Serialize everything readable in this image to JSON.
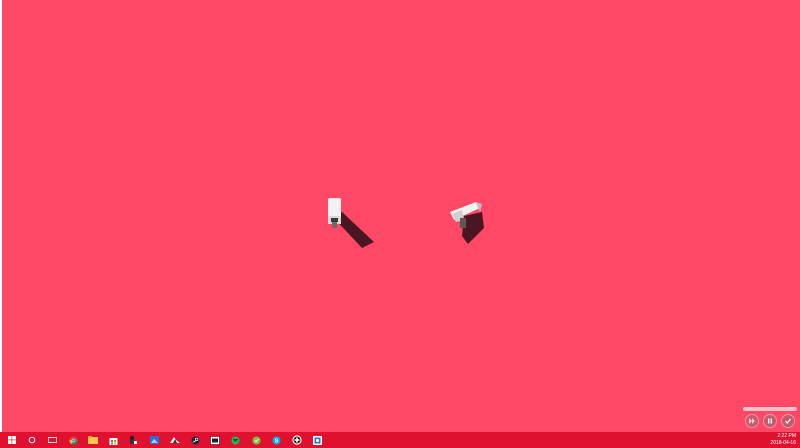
{
  "desktop": {
    "background_color": "#ff4766",
    "items": [
      {
        "name": "security-camera-left",
        "icon": "security-camera-icon"
      },
      {
        "name": "security-camera-right",
        "icon": "security-camera-icon"
      }
    ]
  },
  "overlay": {
    "label": "",
    "buttons": [
      {
        "name": "skip-button",
        "icon": "skip-icon"
      },
      {
        "name": "pause-button",
        "icon": "pause-icon"
      },
      {
        "name": "confirm-button",
        "icon": "check-icon"
      }
    ]
  },
  "taskbar": {
    "color": "#e0102f",
    "items": [
      {
        "name": "start-button",
        "icon": "windows-logo-icon"
      },
      {
        "name": "search-button",
        "icon": "circle-search-icon"
      },
      {
        "name": "task-view-button",
        "icon": "task-view-icon"
      },
      {
        "name": "chrome-button",
        "icon": "chrome-icon"
      },
      {
        "name": "file-explorer-button",
        "icon": "folder-icon"
      },
      {
        "name": "store-button",
        "icon": "store-bag-icon"
      },
      {
        "name": "app-button-1",
        "icon": "figure-icon"
      },
      {
        "name": "photos-button",
        "icon": "photos-icon"
      },
      {
        "name": "app-button-2",
        "icon": "game-controller-icon"
      },
      {
        "name": "steam-button",
        "icon": "steam-icon"
      },
      {
        "name": "app-button-3",
        "icon": "window-icon"
      },
      {
        "name": "spotify-button",
        "icon": "spotify-icon"
      },
      {
        "name": "app-button-4",
        "icon": "green-app-icon"
      },
      {
        "name": "skype-button",
        "icon": "skype-icon"
      },
      {
        "name": "app-button-5",
        "icon": "gear-wheel-icon"
      },
      {
        "name": "app-button-6",
        "icon": "blue-app-icon"
      }
    ],
    "clock": {
      "time": "2:22 PM",
      "date": "2018-04-16"
    }
  }
}
